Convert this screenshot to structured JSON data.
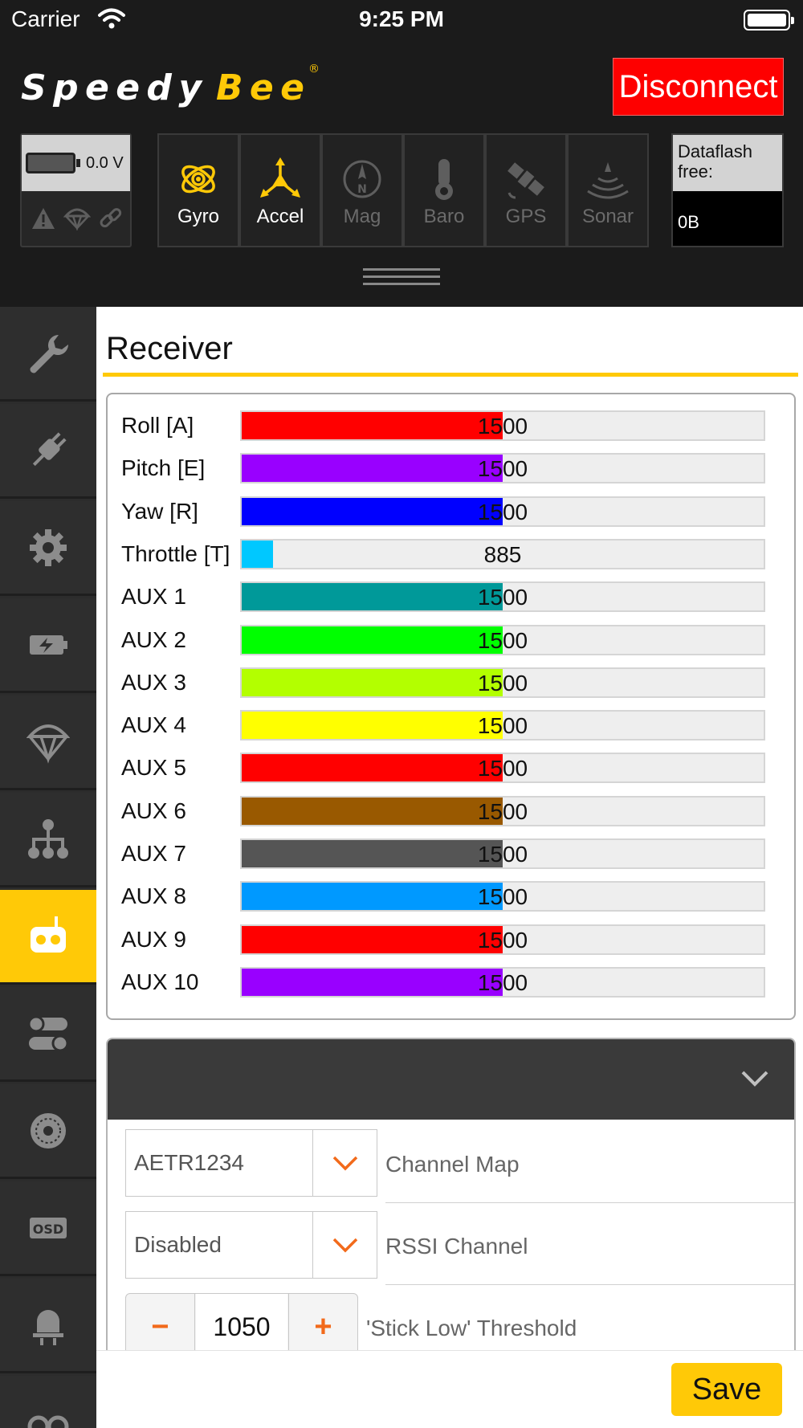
{
  "status_bar": {
    "carrier": "Carrier",
    "time": "9:25 PM"
  },
  "header": {
    "logo_text": "Speedy Bee",
    "disconnect_label": "Disconnect",
    "battery_voltage": "0.0 V",
    "dataflash_label": "Dataflash free:",
    "dataflash_value": "0B"
  },
  "sensors": [
    {
      "label": "Gyro",
      "icon": "gyro-icon",
      "active": true
    },
    {
      "label": "Accel",
      "icon": "accel-icon",
      "active": true
    },
    {
      "label": "Mag",
      "icon": "compass-icon",
      "active": false
    },
    {
      "label": "Baro",
      "icon": "thermometer-icon",
      "active": false
    },
    {
      "label": "GPS",
      "icon": "satellite-icon",
      "active": false
    },
    {
      "label": "Sonar",
      "icon": "sonar-icon",
      "active": false
    }
  ],
  "sidebar": {
    "items": [
      {
        "icon": "wrench-icon"
      },
      {
        "icon": "plug-icon"
      },
      {
        "icon": "gear-icon"
      },
      {
        "icon": "battery-charge-icon"
      },
      {
        "icon": "parachute-icon"
      },
      {
        "icon": "hierarchy-icon"
      },
      {
        "icon": "rc-transmitter-icon",
        "active": true
      },
      {
        "icon": "toggles-icon"
      },
      {
        "icon": "motor-icon"
      },
      {
        "icon": "osd-icon"
      },
      {
        "icon": "beacon-icon"
      },
      {
        "icon": "binoculars-icon"
      }
    ]
  },
  "main": {
    "title": "Receiver",
    "channel_min": 885,
    "channel_max": 2115,
    "channels": [
      {
        "name": "Roll [A]",
        "value": "1500",
        "color": "#ff0000"
      },
      {
        "name": "Pitch [E]",
        "value": "1500",
        "color": "#9900ff"
      },
      {
        "name": "Yaw [R]",
        "value": "1500",
        "color": "#0000ff"
      },
      {
        "name": "Throttle [T]",
        "value": "885",
        "color": "#00c8ff"
      },
      {
        "name": "AUX 1",
        "value": "1500",
        "color": "#009999"
      },
      {
        "name": "AUX 2",
        "value": "1500",
        "color": "#00ff00"
      },
      {
        "name": "AUX 3",
        "value": "1500",
        "color": "#b3ff00"
      },
      {
        "name": "AUX 4",
        "value": "1500",
        "color": "#ffff00"
      },
      {
        "name": "AUX 5",
        "value": "1500",
        "color": "#ff0000"
      },
      {
        "name": "AUX 6",
        "value": "1500",
        "color": "#995900"
      },
      {
        "name": "AUX 7",
        "value": "1500",
        "color": "#555555"
      },
      {
        "name": "AUX 8",
        "value": "1500",
        "color": "#0099ff"
      },
      {
        "name": "AUX 9",
        "value": "1500",
        "color": "#ff0000"
      },
      {
        "name": "AUX 10",
        "value": "1500",
        "color": "#9900ff"
      }
    ],
    "settings": {
      "channel_map": {
        "value": "AETR1234",
        "label": "Channel Map"
      },
      "rssi_channel": {
        "value": "Disabled",
        "label": "RSSI Channel"
      },
      "stick_low": {
        "value": "1050",
        "label": "'Stick Low' Threshold",
        "minus": "−",
        "plus": "+"
      }
    },
    "save_label": "Save"
  },
  "colors": {
    "accent": "#ffc907",
    "disconnect": "#fe0000",
    "stepper": "#f26a1b"
  }
}
